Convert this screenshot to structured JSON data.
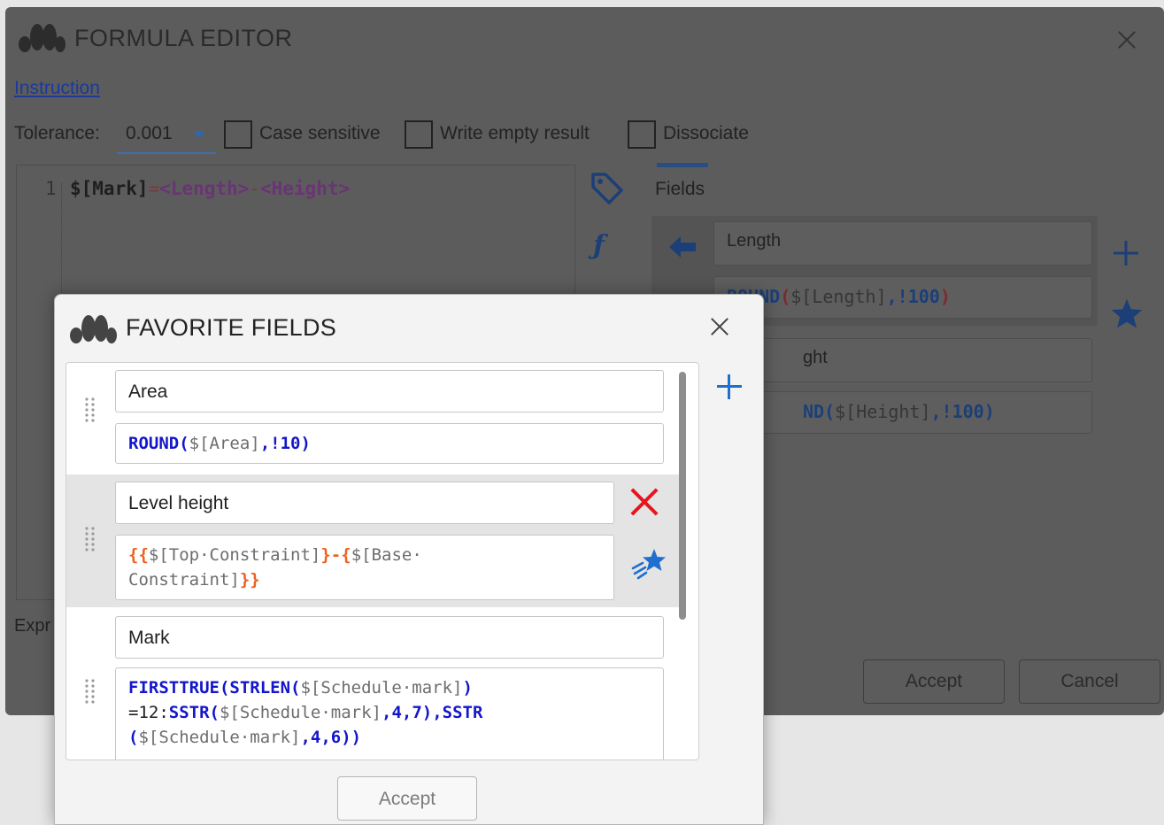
{
  "main_window": {
    "title": "FORMULA EDITOR",
    "instruction_link": "Instruction",
    "tolerance_label": "Tolerance:",
    "tolerance_value": "0.001",
    "checkboxes": {
      "case_sensitive": "Case sensitive",
      "write_empty_result": "Write empty result",
      "dissociate": "Dissociate"
    },
    "editor": {
      "line_number": "1",
      "code_target": "$[Mark]",
      "code_eq": "=",
      "code_length": "<Length>",
      "code_minus": "-",
      "code_height": "<Height>"
    },
    "fields_tab": "Fields",
    "fields": [
      {
        "name": "Length",
        "expr_fn": "ROUND",
        "expr_open": "(",
        "expr_arg": "$[Length]",
        "expr_rest": ",!100",
        "expr_close": ")"
      },
      {
        "name_visible": "ght",
        "expr_visible_fn": "ND(",
        "expr_arg": "$[Height]",
        "expr_rest": ",!100)"
      }
    ],
    "expression_label_partial": "Expr",
    "accept_button": "Accept",
    "cancel_button": "Cancel"
  },
  "favorite_dialog": {
    "title": "FAVORITE FIELDS",
    "items": [
      {
        "name": "Area",
        "expr_fn": "ROUND(",
        "expr_arg": "$[Area]",
        "expr_rest": ",!10)"
      },
      {
        "name": "Level height",
        "expr_open": "{{",
        "expr_arg1": "$[Top·Constraint]",
        "expr_mid": "}-{",
        "expr_arg2_line1": "$[Base·",
        "expr_arg2_line2": "Constraint]",
        "expr_close": "}}"
      },
      {
        "name": "Mark",
        "expr_fn1": "FIRSTTRUE(STRLEN(",
        "expr_arg1": "$[Schedule·mark]",
        "expr_close1": ")",
        "expr_l2_a": "=12:",
        "expr_l2_fn": "SSTR(",
        "expr_l2_arg": "$[Schedule·mark]",
        "expr_l2_rest": ",4,7),SSTR",
        "expr_l3_open": "(",
        "expr_l3_arg": "$[Schedule·mark]",
        "expr_l3_rest": ",4,6))"
      }
    ],
    "accept_button": "Accept"
  },
  "colors": {
    "accent_blue": "#1f6fce",
    "keyword_blue": "#1416c9",
    "brace_orange": "#f0601e",
    "delete_red": "#e5161c",
    "dim_overlay": "#5c5c5c"
  },
  "icons": {
    "logo": "app-logo-icon",
    "close": "close-icon",
    "tag": "tag-icon",
    "function": "function-icon",
    "arrow_left": "arrow-left-icon",
    "add": "plus-icon",
    "favorite": "star-icon",
    "favorite_shooting": "shooting-star-icon",
    "delete": "delete-x-icon",
    "drag": "drag-handle-icon"
  }
}
